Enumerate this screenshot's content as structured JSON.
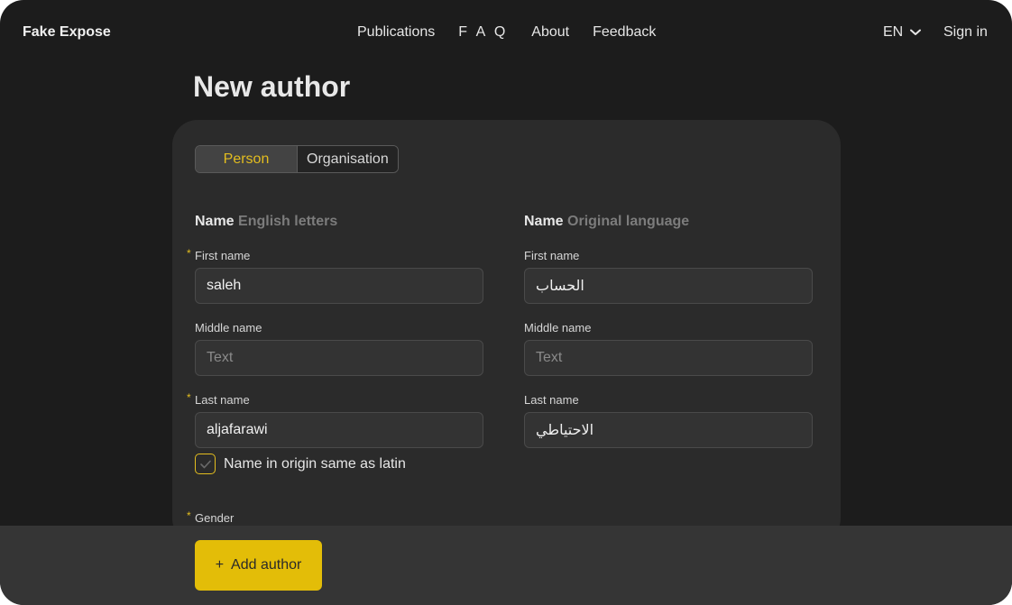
{
  "header": {
    "logo": "Fake Expose",
    "nav": [
      "Publications",
      "F A Q",
      "About",
      "Feedback"
    ],
    "lang": "EN",
    "signin": "Sign in"
  },
  "page_title": "New author",
  "type_switch": {
    "person": "Person",
    "organisation": "Organisation",
    "selected": "Person"
  },
  "latin": {
    "title": "Name",
    "subtitle": "English letters",
    "first_label": "First name",
    "first_value": "saleh",
    "middle_label": "Middle name",
    "middle_placeholder": "Text",
    "last_label": "Last name",
    "last_value": "aljafarawi"
  },
  "original": {
    "title": "Name",
    "subtitle": "Original language",
    "first_label": "First name",
    "first_value": "الحساب",
    "middle_label": "Middle name",
    "middle_placeholder": "Text",
    "last_label": "Last name",
    "last_value": "الاحتياطي"
  },
  "same_as_latin_label": "Name in origin same as latin",
  "same_as_latin_checked": true,
  "gender_label": "Gender",
  "add_button": {
    "icon": "+",
    "label": "Add author"
  },
  "colors": {
    "accent": "#e3bd08",
    "background": "#1c1c1c",
    "card": "#2b2b2b"
  }
}
